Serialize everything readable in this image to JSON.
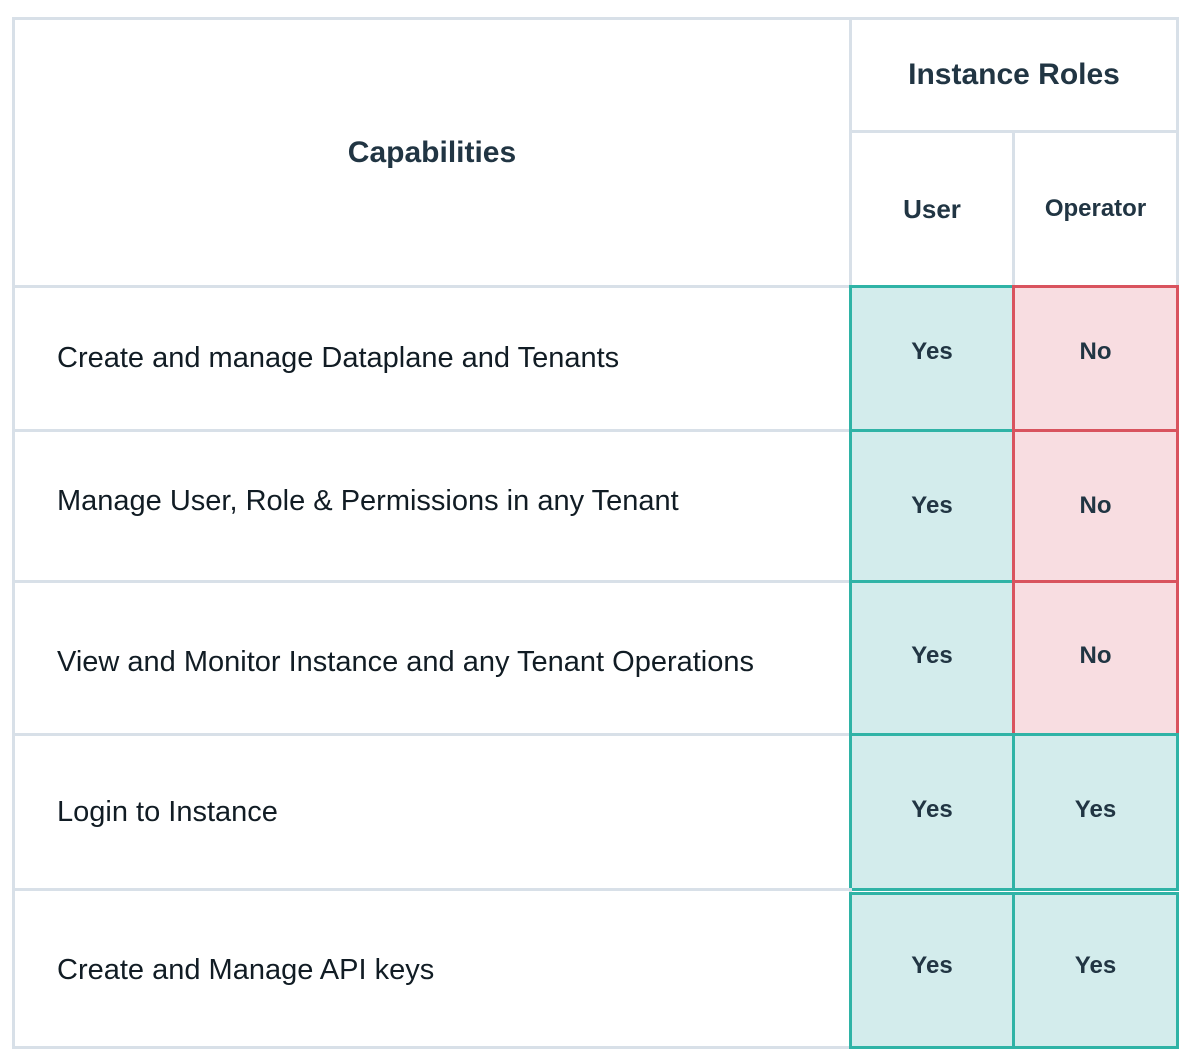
{
  "header": {
    "capabilities": "Capabilities",
    "instance_roles": "Instance Roles",
    "roles": [
      "User",
      "Operator"
    ]
  },
  "rows": [
    {
      "capability": "Create and manage Dataplane and Tenants",
      "user": "Yes",
      "operator": "No"
    },
    {
      "capability": "Manage User, Role & Permissions in any Tenant",
      "user": "Yes",
      "operator": "No"
    },
    {
      "capability": "View and Monitor Instance and any Tenant Operations",
      "user": "Yes",
      "operator": "No"
    },
    {
      "capability": "Login to Instance",
      "user": "Yes",
      "operator": "Yes"
    },
    {
      "capability": "Create and Manage API keys",
      "user": "Yes",
      "operator": "Yes"
    }
  ],
  "colors": {
    "yes_fill": "#d3ecec",
    "yes_border": "#2fb3a6",
    "no_fill": "#f8dde1",
    "no_border": "#d9535e",
    "grid_line": "#d8e0e8",
    "text": "#213543"
  }
}
